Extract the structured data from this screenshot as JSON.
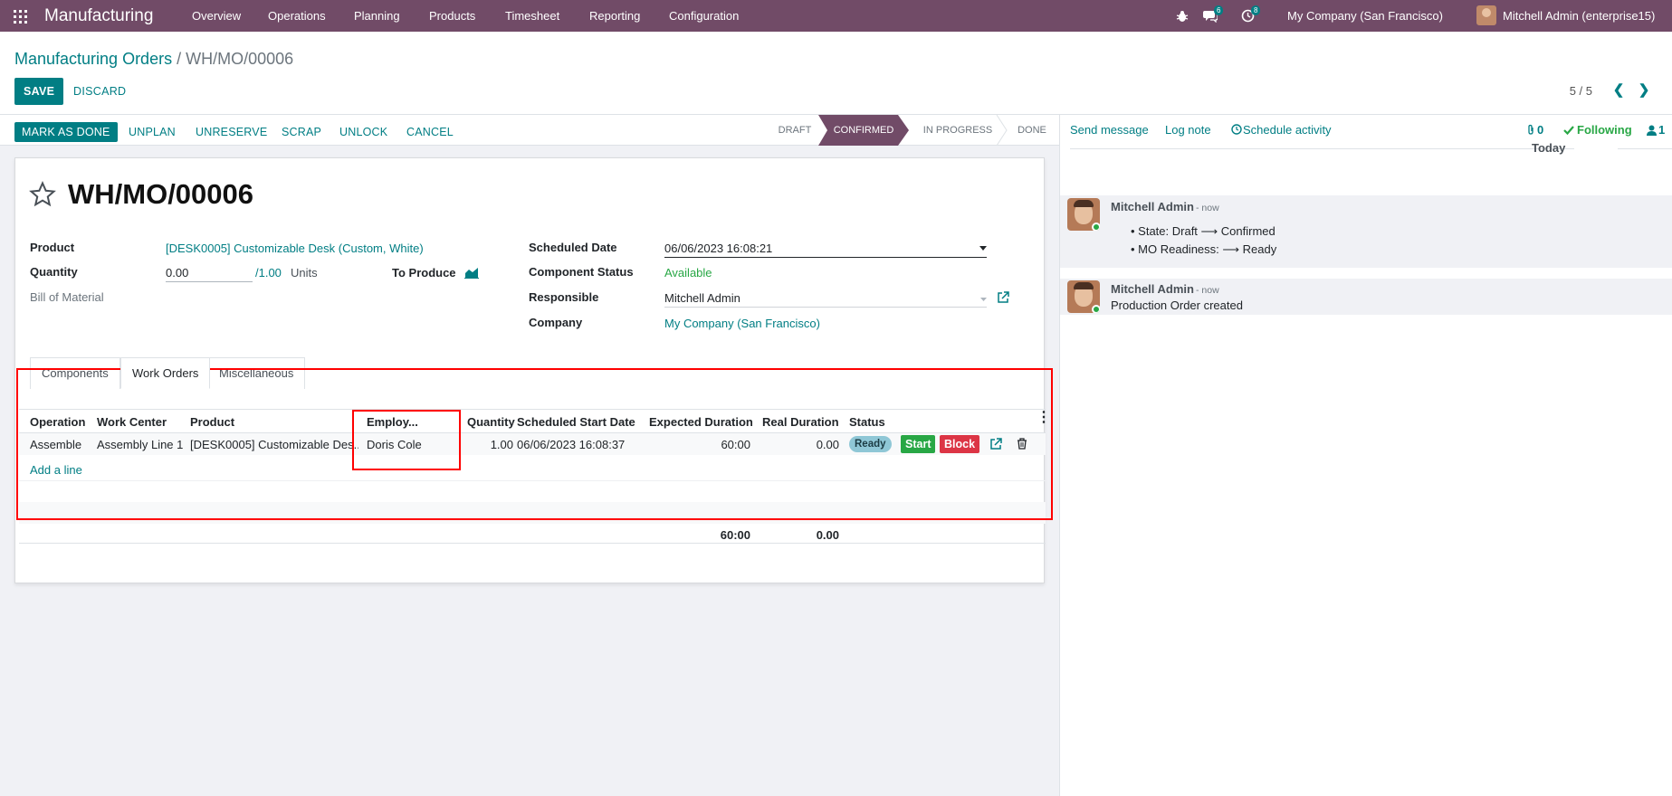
{
  "navbar": {
    "app_name": "Manufacturing",
    "menu": [
      "Overview",
      "Operations",
      "Planning",
      "Products",
      "Timesheet",
      "Reporting",
      "Configuration"
    ],
    "messages_count": "6",
    "activities_count": "8",
    "company": "My Company (San Francisco)",
    "user": "Mitchell Admin (enterprise15)"
  },
  "breadcrumb": {
    "parent": "Manufacturing Orders",
    "separator": "/",
    "current": "WH/MO/00006"
  },
  "control": {
    "save": "SAVE",
    "discard": "DISCARD",
    "pager": "5 / 5"
  },
  "statusbar": {
    "buttons": [
      "MARK AS DONE",
      "UNPLAN",
      "UNRESERVE",
      "SCRAP",
      "UNLOCK",
      "CANCEL"
    ],
    "stages": [
      "DRAFT",
      "CONFIRMED",
      "IN PROGRESS",
      "DONE"
    ],
    "active_stage": "CONFIRMED"
  },
  "form": {
    "title": "WH/MO/00006",
    "product_label": "Product",
    "product_value": "[DESK0005] Customizable Desk (Custom, White)",
    "quantity_label": "Quantity",
    "quantity_value": "0.00",
    "quantity_total": "/1.00",
    "quantity_uom": "Units",
    "to_produce_label": "To Produce",
    "bom_label": "Bill of Material",
    "scheduled_date_label": "Scheduled Date",
    "scheduled_date_value": "06/06/2023 16:08:21",
    "component_status_label": "Component Status",
    "component_status_value": "Available",
    "responsible_label": "Responsible",
    "responsible_value": "Mitchell Admin",
    "company_label": "Company",
    "company_value": "My Company (San Francisco)"
  },
  "tabs": [
    "Components",
    "Work Orders",
    "Miscellaneous"
  ],
  "active_tab": "Work Orders",
  "work_orders": {
    "columns": [
      "Operation",
      "Work Center",
      "Product",
      "Employ...",
      "Quantity",
      "Scheduled Start Date",
      "Expected Duration",
      "Real Duration",
      "Status"
    ],
    "rows": [
      {
        "operation": "Assemble",
        "work_center": "Assembly Line 1",
        "product": "[DESK0005] Customizable Des...",
        "employee": "Doris Cole",
        "quantity": "1.00",
        "start_date": "06/06/2023 16:08:37",
        "expected_duration": "60:00",
        "real_duration": "0.00",
        "status": "Ready",
        "start_label": "Start",
        "block_label": "Block"
      }
    ],
    "add_line": "Add a line",
    "total_expected": "60:00",
    "total_real": "0.00"
  },
  "chatter": {
    "send_message": "Send message",
    "log_note": "Log note",
    "schedule_activity": "Schedule activity",
    "attachments_count": "0",
    "following": "Following",
    "followers_count": "1",
    "date_separator": "Today",
    "messages": [
      {
        "author": "Mitchell Admin",
        "time": "- now",
        "lines": [
          "State: Draft ⟶ Confirmed",
          "MO Readiness: ⟶ Ready"
        ]
      },
      {
        "author": "Mitchell Admin",
        "time": "- now",
        "lines": [
          "Production Order created"
        ]
      }
    ]
  },
  "colors": {
    "navbar": "#714b67",
    "primary": "#017e84",
    "success": "#28a745",
    "danger": "#dc3545",
    "highlight_box": "#ff0000"
  }
}
